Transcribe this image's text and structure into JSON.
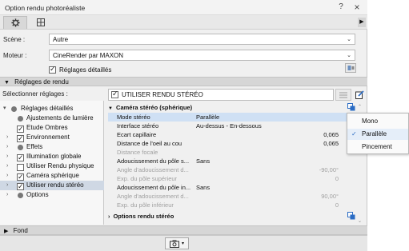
{
  "window": {
    "title": "Option rendu photoréaliste",
    "help_btn": "?",
    "close_btn": "×"
  },
  "tabs": {
    "arrow": "▶"
  },
  "scene": {
    "label": "Scène :",
    "value": "Autre"
  },
  "engine": {
    "label": "Moteur :",
    "value": "CineRender par MAXON"
  },
  "detailed_settings": {
    "label": "Réglages détaillés",
    "checked": true
  },
  "render_settings_section": "Réglages de rendu",
  "select_settings_label": "Sélectionner réglages :",
  "tree": [
    {
      "label": "Réglages détaillés",
      "marker": "dot",
      "expander": "▾",
      "selected": false,
      "indent": 0
    },
    {
      "label": "Ajustements de lumière",
      "marker": "dot",
      "expander": "",
      "selected": false,
      "indent": 1
    },
    {
      "label": "Etude Ombres",
      "marker": "check",
      "expander": "",
      "selected": false,
      "indent": 1
    },
    {
      "label": "Environnement",
      "marker": "check",
      "expander": "›",
      "selected": false,
      "indent": 1
    },
    {
      "label": "Effets",
      "marker": "dot",
      "expander": "›",
      "selected": false,
      "indent": 1
    },
    {
      "label": "Illumination globale",
      "marker": "check",
      "expander": "›",
      "selected": false,
      "indent": 1
    },
    {
      "label": "Utiliser Rendu physique",
      "marker": "empty",
      "expander": "›",
      "selected": false,
      "indent": 1
    },
    {
      "label": "Caméra sphérique",
      "marker": "check",
      "expander": "›",
      "selected": false,
      "indent": 1
    },
    {
      "label": "Utiliser rendu stéréo",
      "marker": "check",
      "expander": "›",
      "selected": true,
      "indent": 1
    },
    {
      "label": "Options",
      "marker": "dot",
      "expander": "›",
      "selected": false,
      "indent": 1
    }
  ],
  "stereo": {
    "header": "UTILISER RENDU STÉRÉO",
    "group1": "Caméra stéréo (sphérique)",
    "group2": "Options rendu stéréo",
    "rows": [
      {
        "key": "Mode stéréo",
        "value": "Parallèle",
        "right": "",
        "dim": false,
        "highlight": true
      },
      {
        "key": "Interface stéréo",
        "value": "Au-dessus - En-dessous",
        "right": "",
        "dim": false,
        "highlight": false
      },
      {
        "key": "Ecart capillaire",
        "value": "",
        "right": "0,065",
        "dim": false,
        "highlight": false
      },
      {
        "key": "Distance de l'oeil au cou",
        "value": "",
        "right": "0,065",
        "dim": false,
        "highlight": false
      },
      {
        "key": "Distance focale",
        "value": "",
        "right": "",
        "dim": true,
        "highlight": false
      },
      {
        "key": "Adoucissement du pôle s...",
        "value": "Sans",
        "right": "",
        "dim": false,
        "highlight": false
      },
      {
        "key": "Angle d'adoucissement d...",
        "value": "",
        "right": "-90,00°",
        "dim": true,
        "highlight": false
      },
      {
        "key": "Exp. du pôle supérieur",
        "value": "",
        "right": "0",
        "dim": true,
        "highlight": false
      },
      {
        "key": "Adoucissement du pôle in...",
        "value": "Sans",
        "right": "",
        "dim": false,
        "highlight": false
      },
      {
        "key": "Angle d'adoucissement d...",
        "value": "",
        "right": "90,00°",
        "dim": true,
        "highlight": false
      },
      {
        "key": "Exp. du pôle inférieur",
        "value": "",
        "right": "0",
        "dim": true,
        "highlight": false
      }
    ]
  },
  "fond_section": "Fond",
  "dropdown": {
    "options": [
      {
        "label": "Mono",
        "selected": false
      },
      {
        "label": "Parallèle",
        "selected": true
      },
      {
        "label": "Pincement",
        "selected": false
      }
    ]
  },
  "colors": {
    "selection": "#cfd8e4",
    "highlight_row": "#cfe0f4",
    "accent": "#2b6cc4",
    "section_bg": "#d6d6d6"
  }
}
